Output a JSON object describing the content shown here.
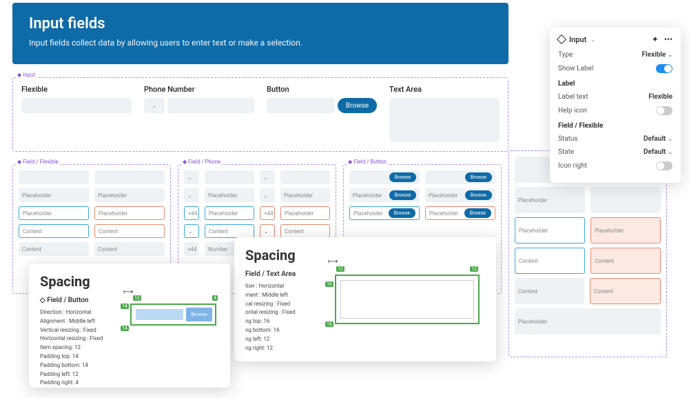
{
  "header": {
    "title": "Input fields",
    "subtitle": "Input fields collect data by allowing users to enter text or make a selection."
  },
  "inputRow": {
    "label": "Input",
    "flexible": {
      "label": "Flexible"
    },
    "phone": {
      "label": "Phone Number"
    },
    "button": {
      "label": "Button",
      "browse": "Browse"
    },
    "textarea": {
      "label": "Text Area"
    }
  },
  "fieldGrids": {
    "flexible": {
      "label": "Field / Flexible",
      "placeholder": "Placeholder",
      "content": "Content"
    },
    "phone": {
      "label": "Field / Phone",
      "prefix": "+44",
      "placeholder": "Placeholder",
      "content": "Content",
      "number": "Number"
    },
    "button": {
      "label": "Field / Button",
      "placeholder": "Placeholder",
      "content": "Content",
      "browse": "Browse"
    },
    "textarea": {
      "placeholder": "Placeholder",
      "content": "Content"
    }
  },
  "spacing1": {
    "title": "Spacing",
    "sub_icon": "◇",
    "sub": "Field / Button",
    "specs": [
      "Direction : Horizontal",
      "Alignment : Middle left",
      "Vertical resizing : Fixed",
      "Horizontal resizing : Fixed",
      "Item spacing: 12",
      "Padding top: 14",
      "Padding bottom: 14",
      "Padding left: 12",
      "Padding right: 4"
    ],
    "diag": {
      "left": "14",
      "left2": "14",
      "top": "12",
      "right": "4",
      "btn": "Browse"
    }
  },
  "spacing2": {
    "title": "Spacing",
    "sub": "Field / Text Area",
    "specs": [
      "tion : Horizontal",
      "ment : Middle left",
      "cal resizing : Fixed",
      "ontal resizing : Fixed",
      "ng top: 16",
      "ng bottom: 16",
      "ng left: 12",
      "ng right: 12"
    ],
    "diag": {
      "top": "12",
      "topR": "12",
      "left": "16",
      "bot": "16"
    }
  },
  "inspector": {
    "title": "Input",
    "type_label": "Type",
    "type_value": "Flexible",
    "showlabel_label": "Show Label",
    "section_label": "Label",
    "labeltext_label": "Label text",
    "labeltext_value": "Flexible",
    "helpicon_label": "Help icon",
    "section_field": "Field / Flexible",
    "status_label": "Status",
    "status_value": "Default",
    "state_label": "State",
    "state_value": "Default",
    "iconright_label": "Icon right"
  }
}
